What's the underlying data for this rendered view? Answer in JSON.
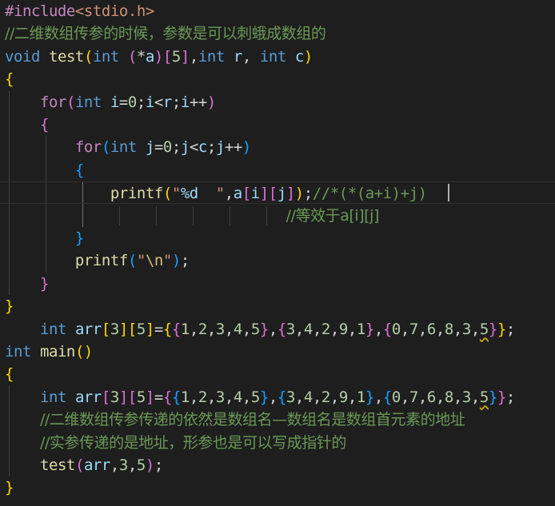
{
  "editor": {
    "theme_colors": {
      "background": "#1e1e1e",
      "default": "#d4d4d4",
      "keyword": "#569cd6",
      "control": "#c586c0",
      "function": "#dcdcaa",
      "variable": "#9cdcfe",
      "number": "#b5cea8",
      "string": "#ce9178",
      "escape": "#d7ba7d",
      "comment": "#6a9955",
      "bracket1": "#ffd700",
      "bracket2": "#da70d6",
      "bracket3": "#179fff",
      "preprocessor": "#c586c0"
    },
    "lines": [
      {
        "tokens": [
          {
            "t": "#include",
            "c": "preprocessor"
          },
          {
            "t": "<stdio.h>",
            "c": "string"
          }
        ]
      },
      {
        "tokens": [
          {
            "t": "//二维数组传参的时候，参数是可以刺蛾成数组的",
            "c": "comment"
          }
        ]
      },
      {
        "tokens": [
          {
            "t": "void",
            "c": "keyword"
          },
          {
            "t": " ",
            "c": "default"
          },
          {
            "t": "test",
            "c": "function"
          },
          {
            "t": "(",
            "c": "bracket1"
          },
          {
            "t": "int",
            "c": "keyword"
          },
          {
            "t": " ",
            "c": "default"
          },
          {
            "t": "(",
            "c": "bracket2"
          },
          {
            "t": "*",
            "c": "default"
          },
          {
            "t": "a",
            "c": "variable"
          },
          {
            "t": ")",
            "c": "bracket2"
          },
          {
            "t": "[",
            "c": "bracket2"
          },
          {
            "t": "5",
            "c": "number"
          },
          {
            "t": "]",
            "c": "bracket2"
          },
          {
            "t": ",",
            "c": "default"
          },
          {
            "t": "int",
            "c": "keyword"
          },
          {
            "t": " ",
            "c": "default"
          },
          {
            "t": "r",
            "c": "variable"
          },
          {
            "t": ", ",
            "c": "default"
          },
          {
            "t": "int",
            "c": "keyword"
          },
          {
            "t": " ",
            "c": "default"
          },
          {
            "t": "c",
            "c": "variable"
          },
          {
            "t": ")",
            "c": "bracket1"
          }
        ]
      },
      {
        "tokens": [
          {
            "t": "{",
            "c": "bracket1"
          }
        ]
      },
      {
        "tokens": [
          {
            "t": "    ",
            "c": "default"
          },
          {
            "t": "for",
            "c": "control"
          },
          {
            "t": "(",
            "c": "bracket2"
          },
          {
            "t": "int",
            "c": "keyword"
          },
          {
            "t": " ",
            "c": "default"
          },
          {
            "t": "i",
            "c": "variable"
          },
          {
            "t": "=",
            "c": "default"
          },
          {
            "t": "0",
            "c": "number"
          },
          {
            "t": ";",
            "c": "default"
          },
          {
            "t": "i",
            "c": "variable"
          },
          {
            "t": "<",
            "c": "default"
          },
          {
            "t": "r",
            "c": "variable"
          },
          {
            "t": ";",
            "c": "default"
          },
          {
            "t": "i",
            "c": "variable"
          },
          {
            "t": "++",
            "c": "default"
          },
          {
            "t": ")",
            "c": "bracket2"
          }
        ]
      },
      {
        "tokens": [
          {
            "t": "    ",
            "c": "default"
          },
          {
            "t": "{",
            "c": "bracket2"
          }
        ]
      },
      {
        "tokens": [
          {
            "t": "        ",
            "c": "default"
          },
          {
            "t": "for",
            "c": "control"
          },
          {
            "t": "(",
            "c": "bracket3"
          },
          {
            "t": "int",
            "c": "keyword"
          },
          {
            "t": " ",
            "c": "default"
          },
          {
            "t": "j",
            "c": "variable"
          },
          {
            "t": "=",
            "c": "default"
          },
          {
            "t": "0",
            "c": "number"
          },
          {
            "t": ";",
            "c": "default"
          },
          {
            "t": "j",
            "c": "variable"
          },
          {
            "t": "<",
            "c": "default"
          },
          {
            "t": "c",
            "c": "variable"
          },
          {
            "t": ";",
            "c": "default"
          },
          {
            "t": "j",
            "c": "variable"
          },
          {
            "t": "++",
            "c": "default"
          },
          {
            "t": ")",
            "c": "bracket3"
          }
        ]
      },
      {
        "tokens": [
          {
            "t": "        ",
            "c": "default"
          },
          {
            "t": "{",
            "c": "bracket3"
          }
        ]
      },
      {
        "tokens": [
          {
            "t": "            ",
            "c": "default"
          },
          {
            "t": "printf",
            "c": "function"
          },
          {
            "t": "(",
            "c": "bracket1"
          },
          {
            "t": "\"",
            "c": "string"
          },
          {
            "t": "%d",
            "c": "variable"
          },
          {
            "t": "  \"",
            "c": "string"
          },
          {
            "t": ",",
            "c": "default"
          },
          {
            "t": "a",
            "c": "variable"
          },
          {
            "t": "[",
            "c": "bracket2"
          },
          {
            "t": "i",
            "c": "variable"
          },
          {
            "t": "]",
            "c": "bracket2"
          },
          {
            "t": "[",
            "c": "bracket2"
          },
          {
            "t": "j",
            "c": "variable"
          },
          {
            "t": "]",
            "c": "bracket2"
          },
          {
            "t": ")",
            "c": "bracket1"
          },
          {
            "t": ";",
            "c": "default"
          },
          {
            "t": "//*(*(a+i)+j)",
            "c": "comment"
          }
        ]
      },
      {
        "tokens": [
          {
            "t": "                                ",
            "c": "default"
          },
          {
            "t": "//等效于a[i][j]",
            "c": "comment"
          }
        ]
      },
      {
        "tokens": [
          {
            "t": "        ",
            "c": "default"
          },
          {
            "t": "}",
            "c": "bracket3"
          }
        ]
      },
      {
        "tokens": [
          {
            "t": "        ",
            "c": "default"
          },
          {
            "t": "printf",
            "c": "function"
          },
          {
            "t": "(",
            "c": "bracket3"
          },
          {
            "t": "\"",
            "c": "string"
          },
          {
            "t": "\\n",
            "c": "escape"
          },
          {
            "t": "\"",
            "c": "string"
          },
          {
            "t": ")",
            "c": "bracket3"
          },
          {
            "t": ";",
            "c": "default"
          }
        ]
      },
      {
        "tokens": [
          {
            "t": "    ",
            "c": "default"
          },
          {
            "t": "}",
            "c": "bracket2"
          }
        ]
      },
      {
        "tokens": [
          {
            "t": "}",
            "c": "bracket1"
          }
        ]
      },
      {
        "tokens": [
          {
            "t": "    ",
            "c": "default"
          },
          {
            "t": "int",
            "c": "keyword"
          },
          {
            "t": " ",
            "c": "default"
          },
          {
            "t": "arr",
            "c": "variable"
          },
          {
            "t": "[",
            "c": "bracket1"
          },
          {
            "t": "3",
            "c": "number"
          },
          {
            "t": "]",
            "c": "bracket1"
          },
          {
            "t": "[",
            "c": "bracket1"
          },
          {
            "t": "5",
            "c": "number"
          },
          {
            "t": "]",
            "c": "bracket1"
          },
          {
            "t": "=",
            "c": "default"
          },
          {
            "t": "{",
            "c": "bracket1"
          },
          {
            "t": "{",
            "c": "bracket2"
          },
          {
            "t": "1",
            "c": "number"
          },
          {
            "t": ",",
            "c": "default"
          },
          {
            "t": "2",
            "c": "number"
          },
          {
            "t": ",",
            "c": "default"
          },
          {
            "t": "3",
            "c": "number"
          },
          {
            "t": ",",
            "c": "default"
          },
          {
            "t": "4",
            "c": "number"
          },
          {
            "t": ",",
            "c": "default"
          },
          {
            "t": "5",
            "c": "number"
          },
          {
            "t": "}",
            "c": "bracket2"
          },
          {
            "t": ",",
            "c": "default"
          },
          {
            "t": "{",
            "c": "bracket2"
          },
          {
            "t": "3",
            "c": "number"
          },
          {
            "t": ",",
            "c": "default"
          },
          {
            "t": "4",
            "c": "number"
          },
          {
            "t": ",",
            "c": "default"
          },
          {
            "t": "2",
            "c": "number"
          },
          {
            "t": ",",
            "c": "default"
          },
          {
            "t": "9",
            "c": "number"
          },
          {
            "t": ",",
            "c": "default"
          },
          {
            "t": "1",
            "c": "number"
          },
          {
            "t": "}",
            "c": "bracket2"
          },
          {
            "t": ",",
            "c": "default"
          },
          {
            "t": "{",
            "c": "bracket2"
          },
          {
            "t": "0",
            "c": "number"
          },
          {
            "t": ",",
            "c": "default"
          },
          {
            "t": "7",
            "c": "number"
          },
          {
            "t": ",",
            "c": "default"
          },
          {
            "t": "6",
            "c": "number"
          },
          {
            "t": ",",
            "c": "default"
          },
          {
            "t": "8",
            "c": "number"
          },
          {
            "t": ",",
            "c": "default"
          },
          {
            "t": "3",
            "c": "number"
          },
          {
            "t": ",",
            "c": "default"
          },
          {
            "t": "5",
            "c": "number",
            "squiggle": true
          },
          {
            "t": "}",
            "c": "bracket2"
          },
          {
            "t": "}",
            "c": "bracket1"
          },
          {
            "t": ";",
            "c": "default"
          }
        ]
      },
      {
        "tokens": [
          {
            "t": "int",
            "c": "keyword"
          },
          {
            "t": " ",
            "c": "default"
          },
          {
            "t": "main",
            "c": "function"
          },
          {
            "t": "()",
            "c": "bracket1"
          }
        ]
      },
      {
        "tokens": [
          {
            "t": "{",
            "c": "bracket1"
          }
        ]
      },
      {
        "tokens": [
          {
            "t": "    ",
            "c": "default"
          },
          {
            "t": "int",
            "c": "keyword"
          },
          {
            "t": " ",
            "c": "default"
          },
          {
            "t": "arr",
            "c": "variable"
          },
          {
            "t": "[",
            "c": "bracket2"
          },
          {
            "t": "3",
            "c": "number"
          },
          {
            "t": "]",
            "c": "bracket2"
          },
          {
            "t": "[",
            "c": "bracket2"
          },
          {
            "t": "5",
            "c": "number"
          },
          {
            "t": "]",
            "c": "bracket2"
          },
          {
            "t": "=",
            "c": "default"
          },
          {
            "t": "{",
            "c": "bracket2"
          },
          {
            "t": "{",
            "c": "bracket3"
          },
          {
            "t": "1",
            "c": "number"
          },
          {
            "t": ",",
            "c": "default"
          },
          {
            "t": "2",
            "c": "number"
          },
          {
            "t": ",",
            "c": "default"
          },
          {
            "t": "3",
            "c": "number"
          },
          {
            "t": ",",
            "c": "default"
          },
          {
            "t": "4",
            "c": "number"
          },
          {
            "t": ",",
            "c": "default"
          },
          {
            "t": "5",
            "c": "number"
          },
          {
            "t": "}",
            "c": "bracket3"
          },
          {
            "t": ",",
            "c": "default"
          },
          {
            "t": "{",
            "c": "bracket3"
          },
          {
            "t": "3",
            "c": "number"
          },
          {
            "t": ",",
            "c": "default"
          },
          {
            "t": "4",
            "c": "number"
          },
          {
            "t": ",",
            "c": "default"
          },
          {
            "t": "2",
            "c": "number"
          },
          {
            "t": ",",
            "c": "default"
          },
          {
            "t": "9",
            "c": "number"
          },
          {
            "t": ",",
            "c": "default"
          },
          {
            "t": "1",
            "c": "number"
          },
          {
            "t": "}",
            "c": "bracket3"
          },
          {
            "t": ",",
            "c": "default"
          },
          {
            "t": "{",
            "c": "bracket3"
          },
          {
            "t": "0",
            "c": "number"
          },
          {
            "t": ",",
            "c": "default"
          },
          {
            "t": "7",
            "c": "number"
          },
          {
            "t": ",",
            "c": "default"
          },
          {
            "t": "6",
            "c": "number"
          },
          {
            "t": ",",
            "c": "default"
          },
          {
            "t": "8",
            "c": "number"
          },
          {
            "t": ",",
            "c": "default"
          },
          {
            "t": "3",
            "c": "number"
          },
          {
            "t": ",",
            "c": "default"
          },
          {
            "t": "5",
            "c": "number",
            "squiggle": true
          },
          {
            "t": "}",
            "c": "bracket3"
          },
          {
            "t": "}",
            "c": "bracket2"
          },
          {
            "t": ";",
            "c": "default"
          }
        ]
      },
      {
        "tokens": [
          {
            "t": "    ",
            "c": "default"
          },
          {
            "t": "//二维数组传参传递的依然是数组名—数组名是数组首元素的地址",
            "c": "comment"
          }
        ]
      },
      {
        "tokens": [
          {
            "t": "    ",
            "c": "default"
          },
          {
            "t": "//实参传递的是地址，形参也是可以写成指针的",
            "c": "comment"
          }
        ]
      },
      {
        "tokens": [
          {
            "t": "    ",
            "c": "default"
          },
          {
            "t": "test",
            "c": "function"
          },
          {
            "t": "(",
            "c": "bracket2"
          },
          {
            "t": "arr",
            "c": "variable"
          },
          {
            "t": ",",
            "c": "default"
          },
          {
            "t": "3",
            "c": "number"
          },
          {
            "t": ",",
            "c": "default"
          },
          {
            "t": "5",
            "c": "number"
          },
          {
            "t": ")",
            "c": "bracket2"
          },
          {
            "t": ";",
            "c": "default"
          }
        ]
      },
      {
        "tokens": [
          {
            "t": "}",
            "c": "bracket1"
          }
        ]
      }
    ]
  }
}
